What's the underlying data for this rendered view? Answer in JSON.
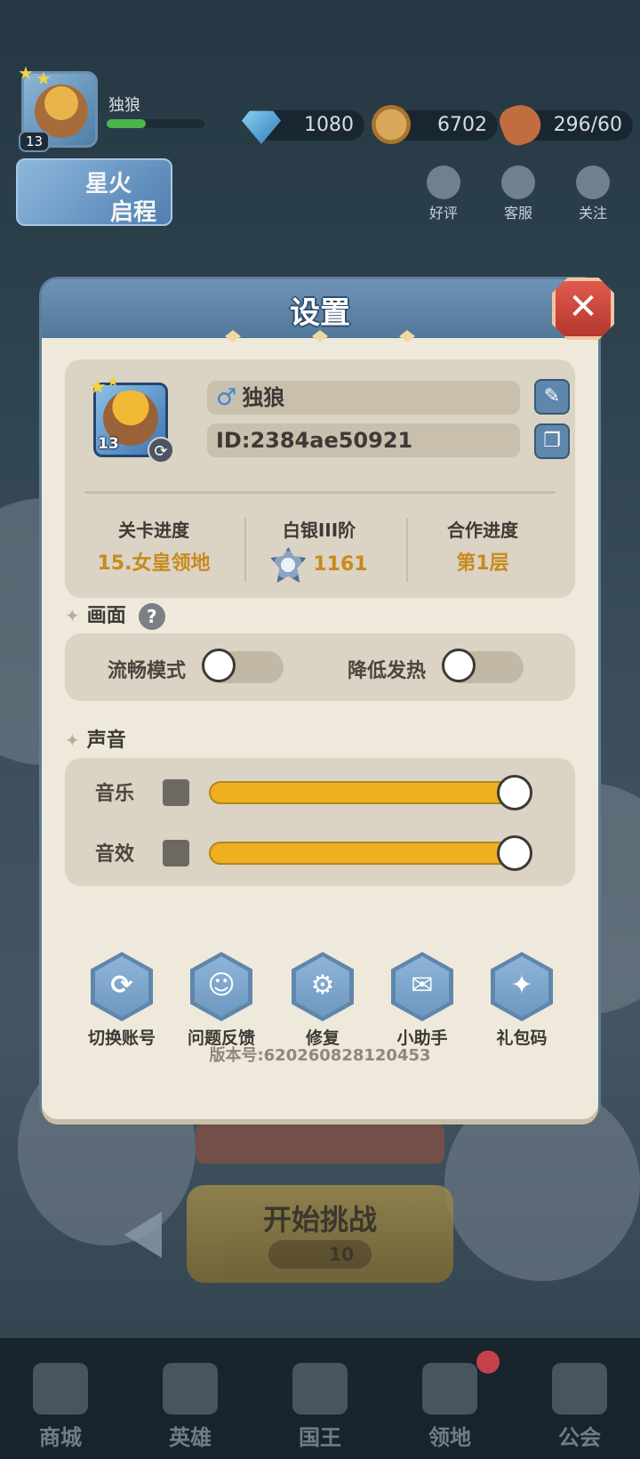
{
  "hud": {
    "player_name": "独狼",
    "level": "13",
    "gems": "1080",
    "coins": "6702",
    "stamina": "296/60",
    "banner_line1": "星火",
    "banner_line2": "启程",
    "buttons": [
      {
        "label": "好评",
        "icon": "thumbs-up-icon"
      },
      {
        "label": "客服",
        "icon": "headset-icon"
      },
      {
        "label": "关注",
        "icon": "star-badge-icon"
      }
    ]
  },
  "modal": {
    "title": "设置",
    "profile": {
      "gender_symbol": "♂",
      "name": "独狼",
      "id": "ID:2384ae50921",
      "level": "13"
    },
    "stats": [
      {
        "label": "关卡进度",
        "value": "15.女皇领地"
      },
      {
        "label": "白银III阶",
        "value": "1161"
      },
      {
        "label": "合作进度",
        "value": "第1层"
      }
    ],
    "graphics_section": "画面",
    "help_symbol": "?",
    "toggles": [
      {
        "label": "流畅模式",
        "on": false
      },
      {
        "label": "降低发热",
        "on": false
      }
    ],
    "sound_section": "声音",
    "sliders": [
      {
        "label": "音乐",
        "value": 1.0
      },
      {
        "label": "音效",
        "value": 1.0
      }
    ],
    "actions": [
      {
        "label": "切换账号",
        "icon": "switch-account-icon",
        "glyph": "⟳"
      },
      {
        "label": "问题反馈",
        "icon": "feedback-icon",
        "glyph": "☺"
      },
      {
        "label": "修复",
        "icon": "gear-repair-icon",
        "glyph": "⚙"
      },
      {
        "label": "小助手",
        "icon": "wechat-icon",
        "glyph": "✉"
      },
      {
        "label": "礼包码",
        "icon": "gift-icon",
        "glyph": "✦"
      }
    ],
    "version": "版本号:620260828120453"
  },
  "bottom": {
    "start_label": "开始挑战",
    "start_cost": "10",
    "nav": [
      "商城",
      "英雄",
      "国王",
      "领地",
      "公会"
    ]
  }
}
